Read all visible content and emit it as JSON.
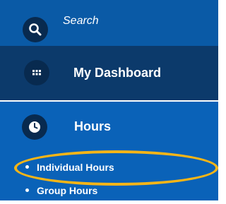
{
  "search": {
    "label": "Search",
    "icon": "search-icon"
  },
  "dashboard": {
    "label": "My Dashboard",
    "icon": "grid-icon"
  },
  "hours": {
    "label": "Hours",
    "icon": "clock-icon",
    "items": [
      {
        "label": "Individual Hours"
      },
      {
        "label": "Group Hours"
      }
    ]
  },
  "colors": {
    "search_bg": "#0a5aa6",
    "dashboard_bg": "#0c3a6b",
    "hours_bg": "#0a62b8",
    "icon_circle": "#082a4f",
    "highlight_ellipse": "#f7b517"
  }
}
